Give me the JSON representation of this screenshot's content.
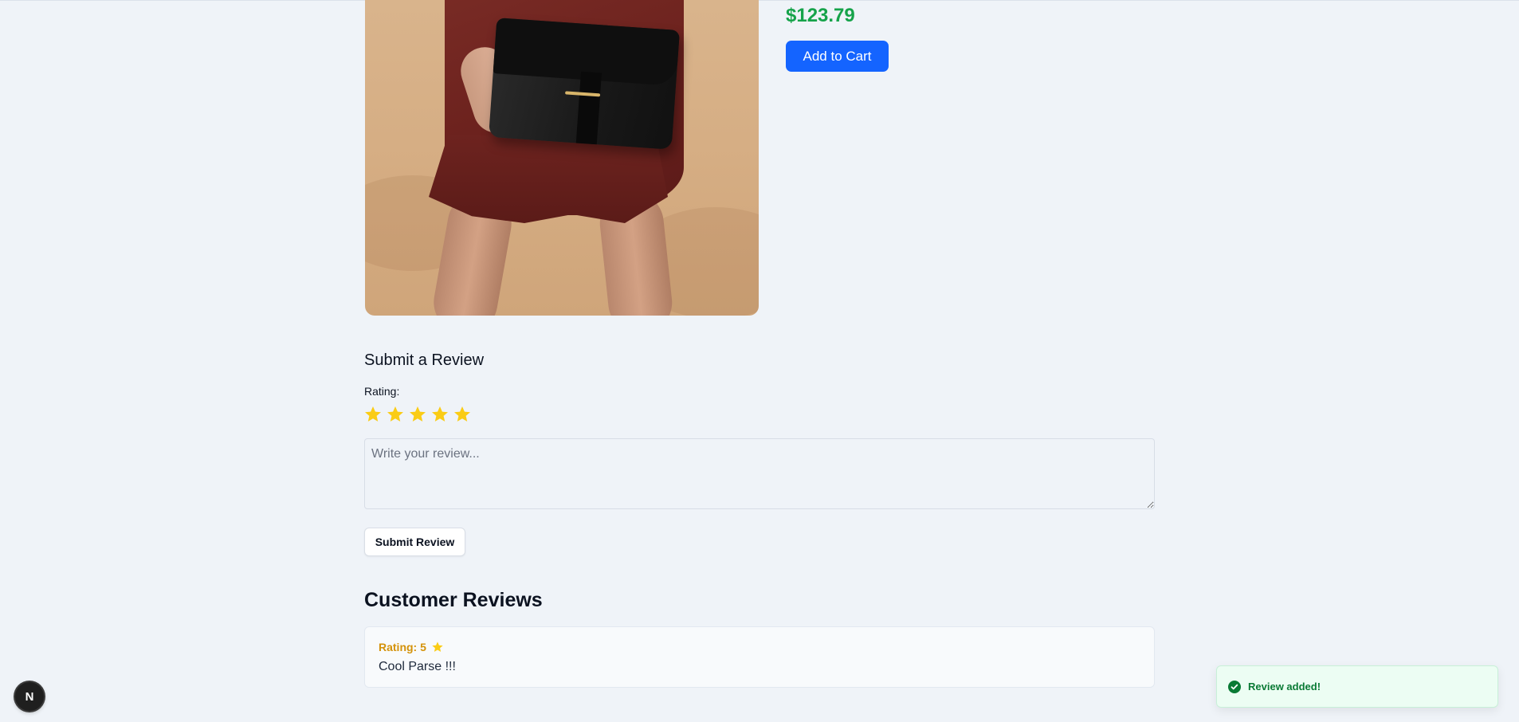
{
  "product": {
    "price": "$123.79",
    "add_to_cart_label": "Add to Cart",
    "image_icon": "product-photo-woman-with-black-handbag"
  },
  "review_form": {
    "heading": "Submit a Review",
    "rating_label": "Rating:",
    "selected_rating": 5,
    "max_rating": 5,
    "star_color": "#facc15",
    "textarea_placeholder": "Write your review...",
    "textarea_value": "",
    "submit_label": "Submit Review"
  },
  "reviews": {
    "heading": "Customer Reviews",
    "items": [
      {
        "rating_text": "Rating: 5",
        "text": "Cool Parse !!!"
      }
    ]
  },
  "toast": {
    "message": "Review added!",
    "icon": "check-circle-icon",
    "color": "#0a7a35"
  },
  "dev_badge": {
    "letter": "N"
  },
  "colors": {
    "background": "#eff3f8",
    "price": "#16a34a",
    "primary_button": "#1464ff",
    "review_rating": "#d4920a"
  }
}
